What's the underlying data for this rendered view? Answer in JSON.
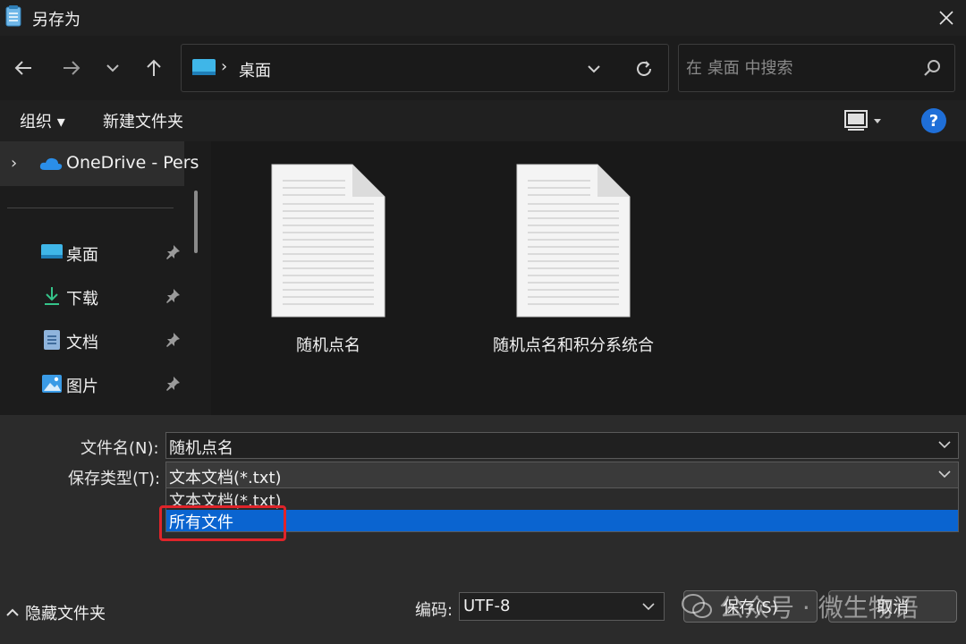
{
  "window": {
    "title": "另存为"
  },
  "address": {
    "crumb": "桌面",
    "separator": "›"
  },
  "search": {
    "placeholder": "在 桌面 中搜索"
  },
  "toolbar": {
    "organize": "组织 ▾",
    "new_folder": "新建文件夹",
    "help": "?"
  },
  "sidebar": {
    "onedrive": "OneDrive - Pers",
    "items": [
      {
        "label": "桌面",
        "icon": "desktop-icon"
      },
      {
        "label": "下载",
        "icon": "download-icon"
      },
      {
        "label": "文档",
        "icon": "document-icon"
      },
      {
        "label": "图片",
        "icon": "pictures-icon"
      }
    ]
  },
  "files": [
    {
      "name": "随机点名"
    },
    {
      "name": "随机点名和积分系统合"
    }
  ],
  "form": {
    "filename_label": "文件名(N):",
    "filename_value": "随机点名",
    "type_label": "保存类型(T):",
    "type_value": "文本文档(*.txt)",
    "type_options": [
      "文本文档(*.txt)",
      "所有文件"
    ],
    "selected_option": "所有文件"
  },
  "footer": {
    "hide_folders": "隐藏文件夹",
    "encoding_label": "编码:",
    "encoding_value": "UTF-8",
    "save_button": "保存(S)",
    "cancel_button": "取消"
  },
  "watermark": {
    "text": "公众号 · 微生物语"
  },
  "colors": {
    "accent": "#0a64d0",
    "highlight": "#e0242a",
    "help": "#1f6fd8"
  }
}
